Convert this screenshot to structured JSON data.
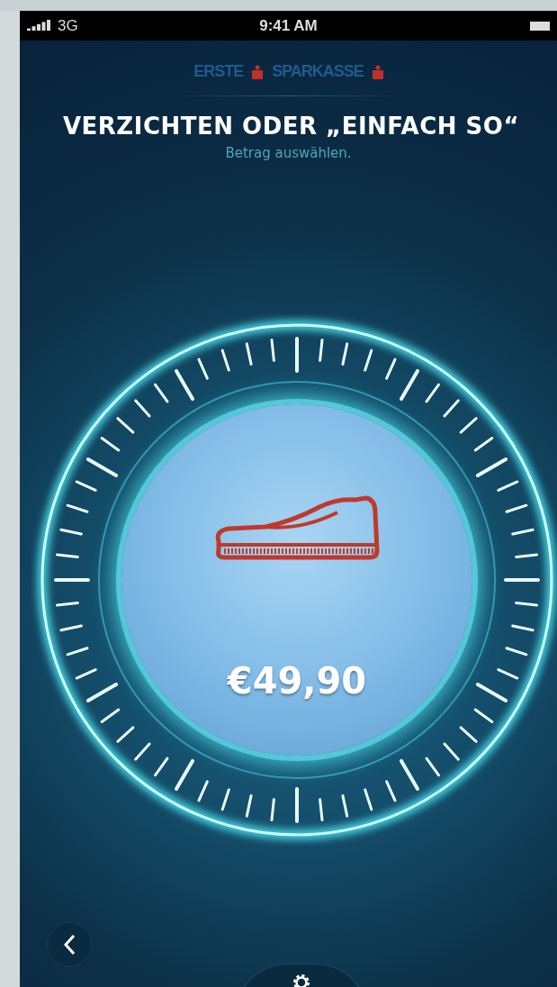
{
  "status_bar": {
    "carrier": "3G",
    "time": "9:41 AM"
  },
  "logo": {
    "left": "ERSTE",
    "right": "SPARKASSE"
  },
  "title": "VERZICHTEN ODER „EINFACH SO“",
  "subtitle": "Betrag auswählen.",
  "dial": {
    "amount": "€49,90"
  }
}
